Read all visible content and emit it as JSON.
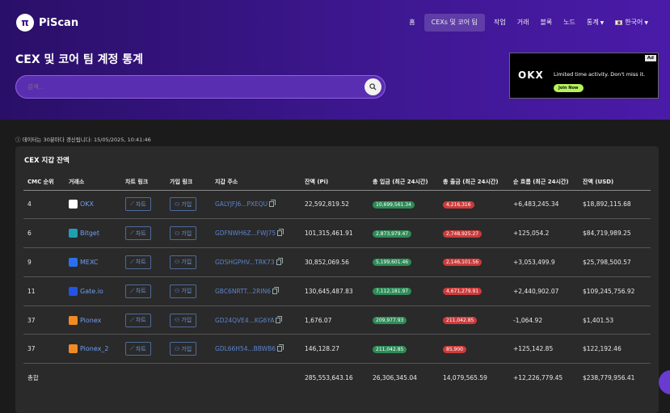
{
  "app": {
    "logo_glyph": "π",
    "name": "PiScan"
  },
  "nav": {
    "items": [
      "홈",
      "CEXs 및 코어 팀",
      "작업",
      "거래",
      "블록",
      "노드",
      "통계"
    ],
    "language": "한국어"
  },
  "page": {
    "title": "CEX 및 코어 팀 계정 통계"
  },
  "search": {
    "placeholder": "검색..."
  },
  "ad": {
    "badge": "Ad",
    "logo": "OKX",
    "text": "Limited time activity. Don't miss it.",
    "button": "Join Now"
  },
  "update_note": "ⓘ 데이터는 30분마다 갱신됩니다: 15/05/2025, 10:41:46",
  "card": {
    "title": "CEX 지갑 잔액"
  },
  "table": {
    "headers": [
      "CMC 순위",
      "거래소",
      "차트 링크",
      "가입 링크",
      "지갑 주소",
      "잔액 (Pi)",
      "총 입금 (최근 24시간)",
      "총 출금 (최근 24시간)",
      "순 흐름 (최근 24시간)",
      "잔액 (USD)"
    ],
    "chart_label": "차트",
    "join_label": "가입",
    "rows": [
      {
        "rank": "4",
        "exchange": "OKX",
        "icon_color": "#ffffff",
        "icon_name": "okx-icon",
        "address": "GALYJFJ6...PXEQU",
        "balance": "22,592,819.52",
        "deposit": "10,699,561.34",
        "withdraw": "4,216,316",
        "net": "+6,483,245.34",
        "usd": "$18,892,115.68"
      },
      {
        "rank": "6",
        "exchange": "Bitget",
        "icon_color": "#1da2b4",
        "icon_name": "bitget-icon",
        "address": "GDFNWH6Z...FWJ75",
        "balance": "101,315,461.91",
        "deposit": "2,873,979.47",
        "withdraw": "2,748,925.27",
        "net": "+125,054.2",
        "usd": "$84,719,989.25"
      },
      {
        "rank": "9",
        "exchange": "MEXC",
        "icon_color": "#2a6ff0",
        "icon_name": "mexc-icon",
        "address": "GDSHGPHV...TRK73",
        "balance": "30,852,069.56",
        "deposit": "5,199,601.46",
        "withdraw": "2,146,101.56",
        "net": "+3,053,499.9",
        "usd": "$25,798,500.57"
      },
      {
        "rank": "11",
        "exchange": "Gate.io",
        "icon_color": "#2354e6",
        "icon_name": "gateio-icon",
        "address": "GBC6NRTT...2RIN6",
        "balance": "130,645,487.83",
        "deposit": "7,112,181.97",
        "withdraw": "4,671,279.91",
        "net": "+2,440,902.07",
        "usd": "$109,245,756.92"
      },
      {
        "rank": "37",
        "exchange": "Pionex",
        "icon_color": "#f08a24",
        "icon_name": "pionex-icon",
        "address": "GD24QVE4...KG6YA",
        "balance": "1,676.07",
        "deposit": "209,977.93",
        "withdraw": "211,042.85",
        "net": "-1,064.92",
        "usd": "$1,401.53"
      },
      {
        "rank": "37",
        "exchange": "Pionex_2",
        "icon_color": "#f08a24",
        "icon_name": "pionex-icon",
        "address": "GDL66H54...BBWB6",
        "balance": "146,128.27",
        "deposit": "211,042.85",
        "withdraw": "85,900",
        "net": "+125,142.85",
        "usd": "$122,192.46"
      }
    ],
    "total": {
      "label": "총합",
      "balance": "285,553,643.16",
      "deposit": "26,306,345.04",
      "withdraw": "14,079,565.59",
      "net": "+12,226,779.45",
      "usd": "$238,779,956.41"
    }
  }
}
